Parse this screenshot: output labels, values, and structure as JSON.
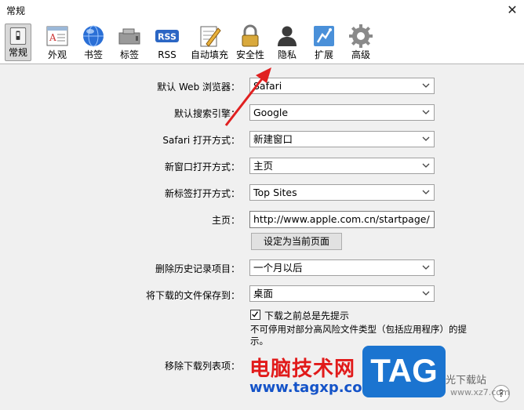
{
  "window": {
    "title": "常规",
    "close_glyph": "✕"
  },
  "toolbar": {
    "items": [
      {
        "label": "常规",
        "icon": "general-switch-icon",
        "selected": true
      },
      {
        "label": "外观",
        "icon": "appearance-icon"
      },
      {
        "label": "书签",
        "icon": "bookmarks-globe-icon"
      },
      {
        "label": "标签",
        "icon": "tabs-icon"
      },
      {
        "label": "RSS",
        "icon": "rss-icon"
      },
      {
        "label": "自动填充",
        "icon": "autofill-icon"
      },
      {
        "label": "安全性",
        "icon": "lock-icon"
      },
      {
        "label": "隐私",
        "icon": "privacy-person-icon"
      },
      {
        "label": "扩展",
        "icon": "extensions-puzzle-icon"
      },
      {
        "label": "高级",
        "icon": "advanced-gear-icon"
      }
    ]
  },
  "settings": {
    "default_browser": {
      "label": "默认 Web 浏览器：",
      "value": "Safari"
    },
    "default_search": {
      "label": "默认搜索引擎：",
      "value": "Google"
    },
    "safari_opens_with": {
      "label": "Safari 打开方式：",
      "value": "新建窗口"
    },
    "new_window_opens_with": {
      "label": "新窗口打开方式：",
      "value": "主页"
    },
    "new_tab_opens_with": {
      "label": "新标签打开方式：",
      "value": "Top Sites"
    },
    "homepage": {
      "label": "主页：",
      "value": "http://www.apple.com.cn/startpage/",
      "button": "设定为当前页面"
    },
    "remove_history": {
      "label": "删除历史记录项目：",
      "value": "一个月以后"
    },
    "save_downloads_to": {
      "label": "将下载的文件保存到：",
      "value": "桌面"
    },
    "ask_before_download": {
      "label": "下载之前总是先提示",
      "checked": true,
      "hint": "不可停用对部分高风险文件类型（包括应用程序）的提示。"
    },
    "remove_download_list": {
      "label": "移除下载列表项："
    }
  },
  "help": {
    "label": "?"
  },
  "watermark": {
    "site_name": "电脑技术网",
    "url": "www.tagxp.com",
    "tag": "TAG",
    "right_text": "光下载站",
    "right_url": "www.xz7.com"
  },
  "colors": {
    "annotation_arrow": "#e02020",
    "watermark_red": "#e11a1a",
    "watermark_blue": "#1b74d0"
  }
}
